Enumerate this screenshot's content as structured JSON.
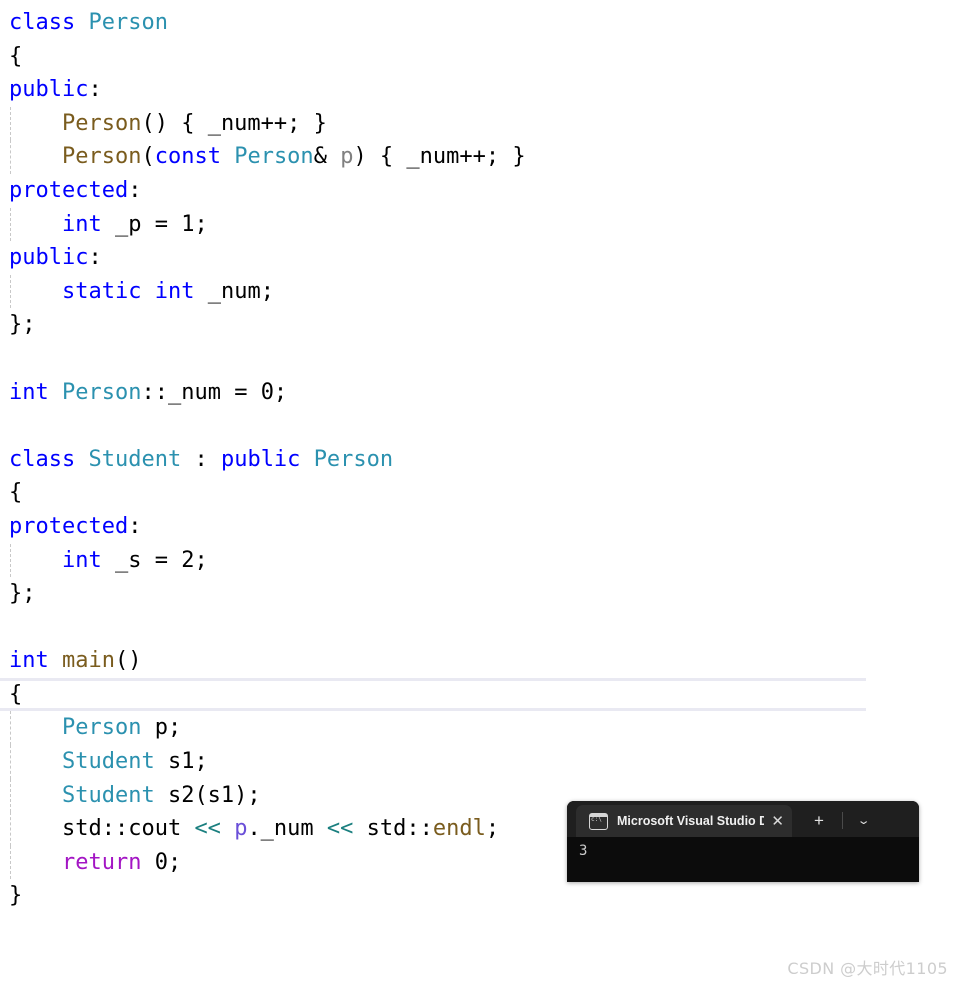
{
  "editor": {
    "language": "cpp",
    "background_color": "#ffffff",
    "current_line_highlight_color": "#e9e9f2",
    "colors": {
      "keyword": "#0000ff",
      "class_type": "#2b91af",
      "function": "#7a5c1e",
      "control": "#a315c4",
      "operator": "#1a7f7f",
      "parameter": "#808080",
      "object_ref": "#6a4fd8",
      "plain": "#000000",
      "indent_guide": "#c8c8c8"
    },
    "lines": [
      {
        "n": 1,
        "guide": false,
        "current": false,
        "tokens": [
          {
            "t": "class",
            "c": "kw"
          },
          {
            "t": " ",
            "c": "pl"
          },
          {
            "t": "Person",
            "c": "type"
          }
        ]
      },
      {
        "n": 2,
        "guide": false,
        "current": false,
        "tokens": [
          {
            "t": "{",
            "c": "pl"
          }
        ]
      },
      {
        "n": 3,
        "guide": false,
        "current": false,
        "tokens": [
          {
            "t": "public",
            "c": "kw"
          },
          {
            "t": ":",
            "c": "pl"
          }
        ]
      },
      {
        "n": 4,
        "guide": true,
        "current": false,
        "tokens": [
          {
            "t": "    ",
            "c": "pl"
          },
          {
            "t": "Person",
            "c": "fn"
          },
          {
            "t": "() { _num++; }",
            "c": "pl"
          }
        ]
      },
      {
        "n": 5,
        "guide": true,
        "current": false,
        "tokens": [
          {
            "t": "    ",
            "c": "pl"
          },
          {
            "t": "Person",
            "c": "fn"
          },
          {
            "t": "(",
            "c": "pl"
          },
          {
            "t": "const",
            "c": "kw"
          },
          {
            "t": " ",
            "c": "pl"
          },
          {
            "t": "Person",
            "c": "type"
          },
          {
            "t": "& ",
            "c": "pl"
          },
          {
            "t": "p",
            "c": "var"
          },
          {
            "t": ") { _num++; }",
            "c": "pl"
          }
        ]
      },
      {
        "n": 6,
        "guide": false,
        "current": false,
        "tokens": [
          {
            "t": "protected",
            "c": "kw"
          },
          {
            "t": ":",
            "c": "pl"
          }
        ]
      },
      {
        "n": 7,
        "guide": true,
        "current": false,
        "tokens": [
          {
            "t": "    ",
            "c": "pl"
          },
          {
            "t": "int",
            "c": "kw"
          },
          {
            "t": " _p = 1;",
            "c": "pl"
          }
        ]
      },
      {
        "n": 8,
        "guide": false,
        "current": false,
        "tokens": [
          {
            "t": "public",
            "c": "kw"
          },
          {
            "t": ":",
            "c": "pl"
          }
        ]
      },
      {
        "n": 9,
        "guide": true,
        "current": false,
        "tokens": [
          {
            "t": "    ",
            "c": "pl"
          },
          {
            "t": "static",
            "c": "kw"
          },
          {
            "t": " ",
            "c": "pl"
          },
          {
            "t": "int",
            "c": "kw"
          },
          {
            "t": " _num;",
            "c": "pl"
          }
        ]
      },
      {
        "n": 10,
        "guide": false,
        "current": false,
        "tokens": [
          {
            "t": "};",
            "c": "pl"
          }
        ]
      },
      {
        "n": 11,
        "guide": false,
        "current": false,
        "tokens": []
      },
      {
        "n": 12,
        "guide": false,
        "current": false,
        "tokens": [
          {
            "t": "int",
            "c": "kw"
          },
          {
            "t": " ",
            "c": "pl"
          },
          {
            "t": "Person",
            "c": "type"
          },
          {
            "t": "::_num = 0;",
            "c": "pl"
          }
        ]
      },
      {
        "n": 13,
        "guide": false,
        "current": false,
        "tokens": []
      },
      {
        "n": 14,
        "guide": false,
        "current": false,
        "tokens": [
          {
            "t": "class",
            "c": "kw"
          },
          {
            "t": " ",
            "c": "pl"
          },
          {
            "t": "Student",
            "c": "type"
          },
          {
            "t": " : ",
            "c": "pl"
          },
          {
            "t": "public",
            "c": "kw"
          },
          {
            "t": " ",
            "c": "pl"
          },
          {
            "t": "Person",
            "c": "type"
          }
        ]
      },
      {
        "n": 15,
        "guide": false,
        "current": false,
        "tokens": [
          {
            "t": "{",
            "c": "pl"
          }
        ]
      },
      {
        "n": 16,
        "guide": false,
        "current": false,
        "tokens": [
          {
            "t": "protected",
            "c": "kw"
          },
          {
            "t": ":",
            "c": "pl"
          }
        ]
      },
      {
        "n": 17,
        "guide": true,
        "current": false,
        "tokens": [
          {
            "t": "    ",
            "c": "pl"
          },
          {
            "t": "int",
            "c": "kw"
          },
          {
            "t": " _s = 2;",
            "c": "pl"
          }
        ]
      },
      {
        "n": 18,
        "guide": false,
        "current": false,
        "tokens": [
          {
            "t": "};",
            "c": "pl"
          }
        ]
      },
      {
        "n": 19,
        "guide": false,
        "current": false,
        "tokens": []
      },
      {
        "n": 20,
        "guide": false,
        "current": false,
        "tokens": [
          {
            "t": "int",
            "c": "kw"
          },
          {
            "t": " ",
            "c": "pl"
          },
          {
            "t": "main",
            "c": "fn"
          },
          {
            "t": "()",
            "c": "pl"
          }
        ]
      },
      {
        "n": 21,
        "guide": false,
        "current": true,
        "tokens": [
          {
            "t": "{",
            "c": "pl"
          }
        ]
      },
      {
        "n": 22,
        "guide": true,
        "current": false,
        "tokens": [
          {
            "t": "    ",
            "c": "pl"
          },
          {
            "t": "Person",
            "c": "type"
          },
          {
            "t": " p;",
            "c": "pl"
          }
        ]
      },
      {
        "n": 23,
        "guide": true,
        "current": false,
        "tokens": [
          {
            "t": "    ",
            "c": "pl"
          },
          {
            "t": "Student",
            "c": "type"
          },
          {
            "t": " s1;",
            "c": "pl"
          }
        ]
      },
      {
        "n": 24,
        "guide": true,
        "current": false,
        "tokens": [
          {
            "t": "    ",
            "c": "pl"
          },
          {
            "t": "Student",
            "c": "type"
          },
          {
            "t": " s2(s1);",
            "c": "pl"
          }
        ]
      },
      {
        "n": 25,
        "guide": true,
        "current": false,
        "tokens": [
          {
            "t": "    std::cout ",
            "c": "pl"
          },
          {
            "t": "<<",
            "c": "op"
          },
          {
            "t": " ",
            "c": "pl"
          },
          {
            "t": "p",
            "c": "obj"
          },
          {
            "t": "._num ",
            "c": "pl"
          },
          {
            "t": "<<",
            "c": "op"
          },
          {
            "t": " std::",
            "c": "pl"
          },
          {
            "t": "endl",
            "c": "fn"
          },
          {
            "t": ";",
            "c": "pl"
          }
        ]
      },
      {
        "n": 26,
        "guide": true,
        "current": false,
        "tokens": [
          {
            "t": "    ",
            "c": "pl"
          },
          {
            "t": "return",
            "c": "ctrl"
          },
          {
            "t": " 0;",
            "c": "pl"
          }
        ]
      },
      {
        "n": 27,
        "guide": false,
        "current": false,
        "tokens": [
          {
            "t": "}",
            "c": "pl"
          }
        ]
      }
    ],
    "source_text": "class Person\n{\npublic:\n    Person() { _num++; }\n    Person(const Person& p) { _num++; }\nprotected:\n    int _p = 1;\npublic:\n    static int _num;\n};\n\nint Person::_num = 0;\n\nclass Student : public Person\n{\nprotected:\n    int _s = 2;\n};\n\nint main()\n{\n    Person p;\n    Student s1;\n    Student s2(s1);\n    std::cout << p._num << std::endl;\n    return 0;\n}"
  },
  "terminal": {
    "tab": {
      "icon": "console-icon",
      "icon_label": "c:\\",
      "title": "Microsoft Visual Studio Debug",
      "close_label": "✕"
    },
    "new_tab_label": "+",
    "dropdown_label": "⌄",
    "output_lines": [
      "3"
    ],
    "titlebar_color": "#1f1f1f",
    "tab_color": "#2d2d2d",
    "body_color": "#0c0c0c",
    "text_color": "#cccccc"
  },
  "watermark": {
    "text": "CSDN @大时代1105",
    "color": "#cdcdcd"
  }
}
